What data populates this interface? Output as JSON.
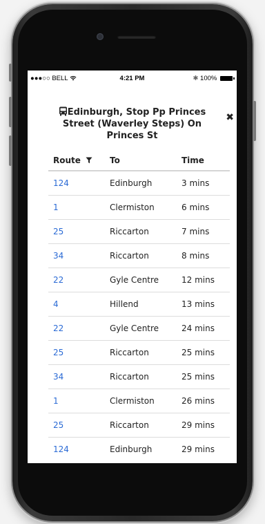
{
  "status_bar": {
    "carrier": "●●●○○ BELL",
    "time": "4:21 PM",
    "bluetooth": "✱",
    "battery_pct": "100%"
  },
  "panel": {
    "title": "Edinburgh, Stop Pp Princes Street (Waverley Steps) On Princes St",
    "close_glyph": "✖",
    "icons": {
      "bus": "bus-icon",
      "close": "close-icon",
      "filter": "filter-icon",
      "wifi": "wifi-icon"
    }
  },
  "table": {
    "headers": {
      "route": "Route",
      "to": "To",
      "time": "Time"
    },
    "rows": [
      {
        "route": "124",
        "to": "Edinburgh",
        "time": "3 mins"
      },
      {
        "route": "1",
        "to": "Clermiston",
        "time": "6 mins"
      },
      {
        "route": "25",
        "to": "Riccarton",
        "time": "7 mins"
      },
      {
        "route": "34",
        "to": "Riccarton",
        "time": "8 mins"
      },
      {
        "route": "22",
        "to": "Gyle Centre",
        "time": "12 mins"
      },
      {
        "route": "4",
        "to": "Hillend",
        "time": "13 mins"
      },
      {
        "route": "22",
        "to": "Gyle Centre",
        "time": "24 mins"
      },
      {
        "route": "25",
        "to": "Riccarton",
        "time": "25 mins"
      },
      {
        "route": "34",
        "to": "Riccarton",
        "time": "25 mins"
      },
      {
        "route": "1",
        "to": "Clermiston",
        "time": "26 mins"
      },
      {
        "route": "25",
        "to": "Riccarton",
        "time": "29 mins"
      },
      {
        "route": "124",
        "to": "Edinburgh",
        "time": "29 mins"
      }
    ]
  },
  "colors": {
    "link": "#2a6ad5",
    "text": "#222222",
    "divider": "#dcdcdc"
  }
}
